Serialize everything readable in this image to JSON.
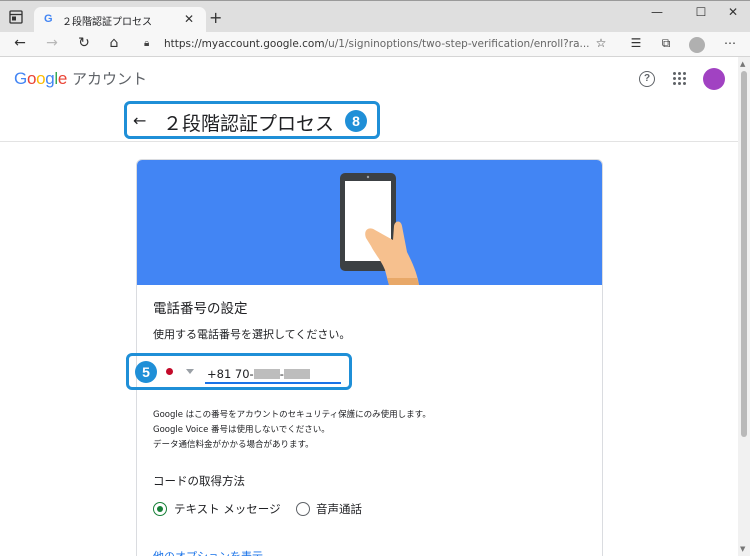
{
  "browser": {
    "tab_title": "２段階認証プロセス",
    "tab_favicon": "G",
    "url_main": "https://myaccount.google.com",
    "url_rest": "/u/1/signinoptions/two-step-verification/enroll?ra...",
    "icons": [
      "window-menu-icon",
      "close-tab-icon",
      "new-tab-icon",
      "minimize-icon",
      "maximize-icon",
      "close-window-icon",
      "back-icon",
      "forward-icon",
      "reload-icon",
      "home-icon",
      "lock-icon",
      "favorites-add-icon",
      "favorites-icon",
      "collections-icon",
      "profile-icon",
      "more-icon"
    ]
  },
  "header": {
    "logo": "Google",
    "product": "アカウント",
    "avatar_color": "#a142c2"
  },
  "page": {
    "title": "２段階認証プロセス",
    "back_icon": "←",
    "title_badge": "8"
  },
  "card": {
    "hero_color": "#4285f4",
    "section_title": "電話番号の設定",
    "instruction": "使用する電話番号を選択してください。",
    "phone_badge": "5",
    "phone_prefix": "+81 70-",
    "notes": [
      "Google はこの番号をアカウントのセキュリティ保護にのみ使用します。",
      "Google Voice 番号は使用しないでください。",
      "データ通信料金がかかる場合があります。"
    ],
    "method_title": "コードの取得方法",
    "methods": [
      {
        "label": "テキスト メッセージ",
        "checked": true
      },
      {
        "label": "音声通話",
        "checked": false
      }
    ],
    "more_options": "他のオプションを表示"
  },
  "colors": {
    "callout": "#1f8fd7",
    "accent": "#1a73e8",
    "radio_checked": "#188038"
  }
}
